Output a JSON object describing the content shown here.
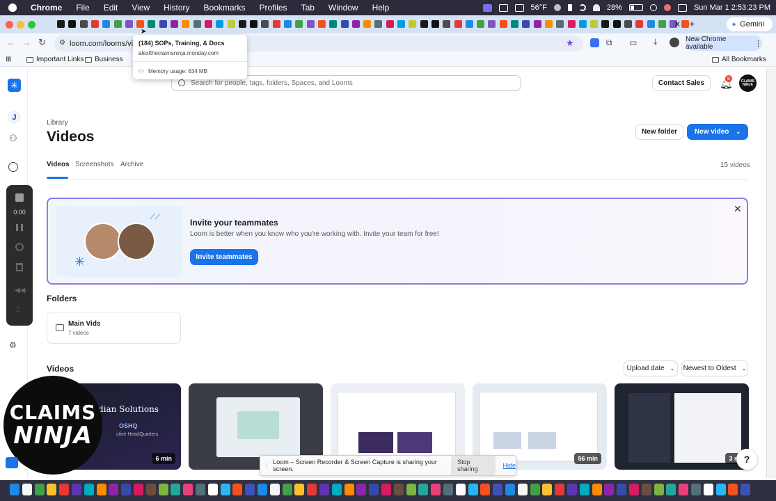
{
  "menubar": {
    "app_name": "Chrome",
    "items": [
      "File",
      "Edit",
      "View",
      "History",
      "Bookmarks",
      "Profiles",
      "Tab",
      "Window",
      "Help"
    ],
    "temperature": "56°F",
    "battery": "28%",
    "datetime": "Sun Mar 1  2:53:23 PM"
  },
  "tabs": {
    "gemini_label": "Gemini",
    "colors": [
      "#1a1a1a",
      "#111",
      "#4b4b4b",
      "#e53935",
      "#1e88e5",
      "#43a047",
      "#7e57c2",
      "#f4511e",
      "#00897b",
      "#3949ab",
      "#8e24aa",
      "#fb8c00",
      "#546e7a",
      "#d81b60",
      "#039be5",
      "#c0ca33"
    ]
  },
  "toolbar": {
    "url": "loom.com/looms/vide",
    "new_chrome_label": "New Chrome available"
  },
  "bookmarks": {
    "items": [
      "Important Links",
      "Business"
    ],
    "all_bookmarks": "All Bookmarks"
  },
  "tooltip": {
    "title": "(184) SOPs, Training, & Docs",
    "domain": "alexftheclaimsninja.monday.com",
    "memory": "Memory usage: 634 MB"
  },
  "sidebar": {
    "workspace_initial": "J",
    "recorder_time": "0:00"
  },
  "header": {
    "search_placeholder": "Search for people, tags, folders, Spaces, and Looms",
    "contact_sales": "Contact Sales",
    "notification_count": "8",
    "avatar_text": "CLAIMS NINJA"
  },
  "library": {
    "breadcrumb": "Library",
    "title": "Videos",
    "new_folder": "New folder",
    "new_video": "New video",
    "tabs": [
      "Videos",
      "Screenshots",
      "Archive"
    ],
    "active_tab": "Videos",
    "count": "15 videos"
  },
  "banner": {
    "title": "Invite your teammates",
    "body": "Loom is better when you know who you're working with. Invite your team for free!",
    "button": "Invite teammates"
  },
  "folders": {
    "heading": "Folders",
    "items": [
      {
        "name": "Main Vids",
        "count": "7 videos"
      }
    ]
  },
  "videos": {
    "heading": "Videos",
    "sort_field": "Upload date",
    "sort_order": "Newest to Oldest",
    "thumbnails": [
      {
        "overlay_title": "dian Solutions",
        "sub_a": "OSHQ",
        "sub_b": "ctive HeadQuarters",
        "duration": "6 min"
      },
      {
        "duration": ""
      },
      {
        "duration": ""
      },
      {
        "duration": "56 min"
      },
      {
        "duration": "3 m"
      }
    ]
  },
  "share_bar": {
    "message": "Loom – Screen Recorder & Screen Capture is sharing your screen.",
    "stop": "Stop sharing",
    "hide": "Hide"
  },
  "ninja_logo": {
    "line1": "CLAIMS",
    "line2": "NINJA"
  },
  "help_label": "?"
}
